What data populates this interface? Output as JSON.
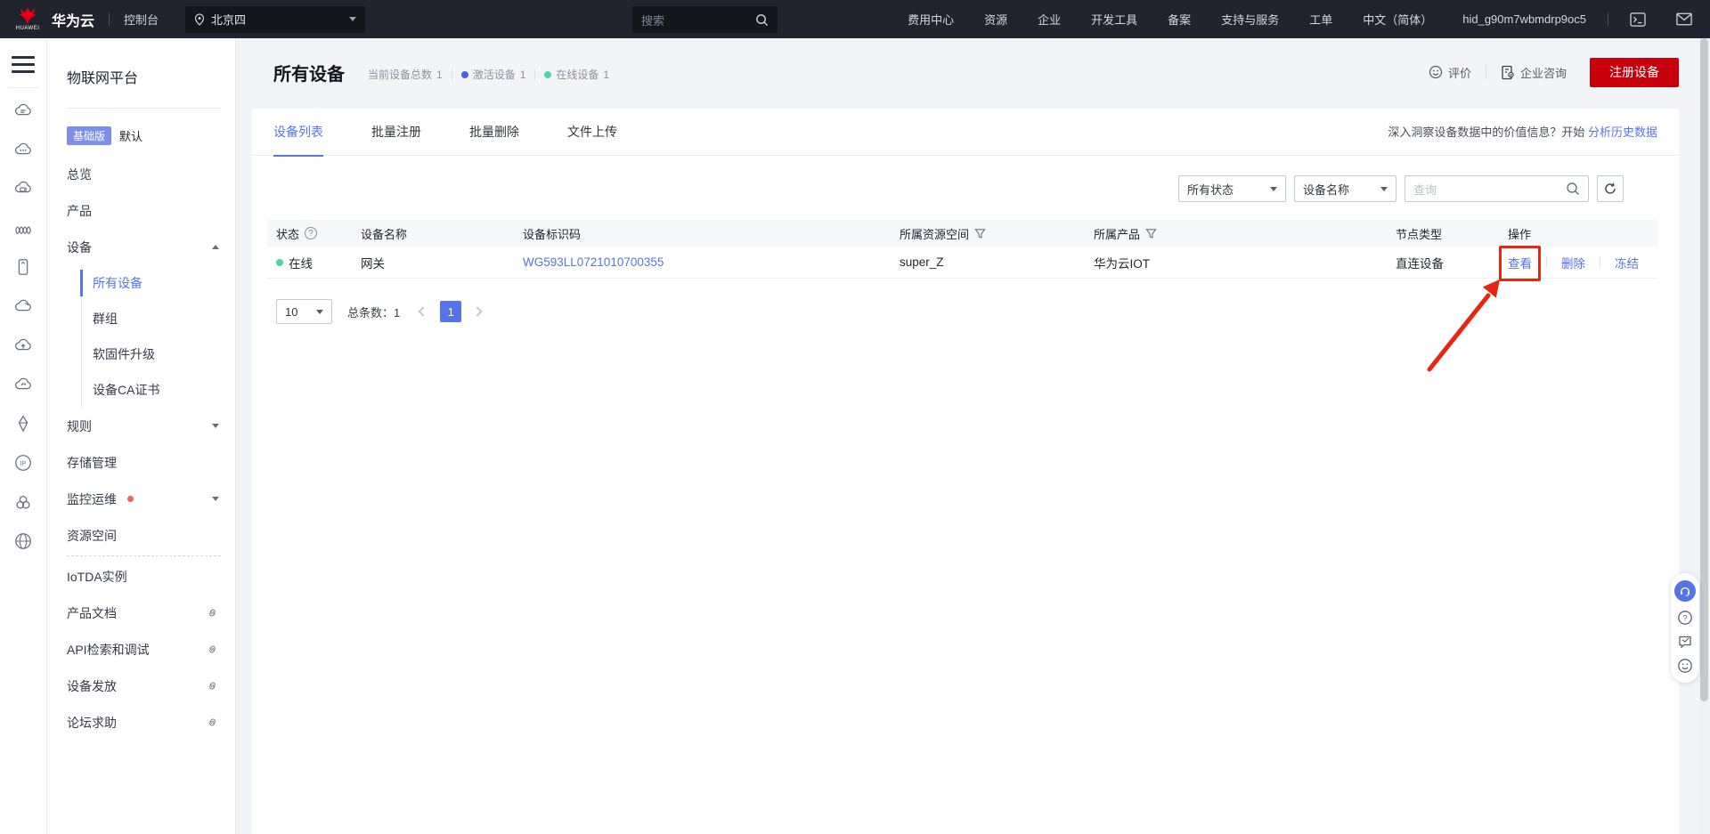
{
  "topbar": {
    "brand": "华为云",
    "brand_sub": "HUAWEI",
    "console": "控制台",
    "region": "北京四",
    "search_placeholder": "搜索",
    "menu": [
      "费用中心",
      "资源",
      "企业",
      "开发工具",
      "备案",
      "支持与服务",
      "工单",
      "中文（简体）",
      "hid_g90m7wbmdrp9oc5"
    ]
  },
  "sidebar": {
    "title": "物联网平台",
    "version_badge": "基础版",
    "version_name": "默认",
    "nav": [
      {
        "label": "总览"
      },
      {
        "label": "产品"
      },
      {
        "label": "设备",
        "expanded": true,
        "children": [
          "所有设备",
          "群组",
          "软固件升级",
          "设备CA证书"
        ],
        "active_child": "所有设备"
      },
      {
        "label": "规则"
      },
      {
        "label": "存储管理"
      },
      {
        "label": "监控运维",
        "badge_dot": true
      },
      {
        "label": "资源空间"
      },
      {
        "label": "IoTDA实例"
      },
      {
        "label": "产品文档",
        "external": true
      },
      {
        "label": "API检索和调试",
        "external": true
      },
      {
        "label": "设备发放",
        "external": true
      },
      {
        "label": "论坛求助",
        "external": true
      }
    ]
  },
  "header": {
    "title": "所有设备",
    "stats": [
      {
        "label": "当前设备总数",
        "value": "1"
      },
      {
        "label": "激活设备",
        "value": "1",
        "dot": "blue"
      },
      {
        "label": "在线设备",
        "value": "1",
        "dot": "green"
      }
    ],
    "feedback": "评价",
    "consult": "企业咨询",
    "register": "注册设备"
  },
  "tabs": [
    "设备列表",
    "批量注册",
    "批量删除",
    "文件上传"
  ],
  "insight": {
    "text": "深入洞察设备数据中的价值信息？开始",
    "link": "分析历史数据"
  },
  "filters": {
    "status": "所有状态",
    "device_field": "设备名称",
    "search_placeholder": "查询"
  },
  "table": {
    "columns": [
      "状态",
      "设备名称",
      "设备标识码",
      "所属资源空间",
      "所属产品",
      "节点类型",
      "操作"
    ],
    "rows": [
      {
        "status": "在线",
        "name": "网关",
        "code": "WG593LL0721010700355",
        "space": "super_Z",
        "product": "华为云IOT",
        "node_type": "直连设备",
        "actions": [
          "查看",
          "删除",
          "冻结"
        ]
      }
    ]
  },
  "pagination": {
    "page_size": "10",
    "total_label": "总条数：1",
    "page": "1"
  },
  "icons": {
    "search": "magnifier",
    "region": "location-pin",
    "refresh": "circular-arrow",
    "filter": "funnel",
    "help": "question-circle",
    "feedback": "smiley",
    "support": "headset",
    "external": "chain-link"
  },
  "colors": {
    "accent_blue": "#5674e6",
    "brand_red": "#c7000b",
    "annotation_red": "#e8250e",
    "online_green": "#50d4ab",
    "activated_blue": "#4b5fe8",
    "badge_blue": "#7d90e8",
    "topbar_bg": "#21242e"
  }
}
